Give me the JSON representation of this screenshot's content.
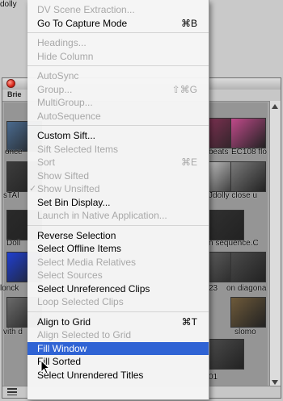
{
  "bin": {
    "tab_label": "Brie",
    "thumbnails": [
      {
        "label": "once",
        "color": "#4a6a8e"
      },
      {
        "label": "",
        "color": "#6a4e58"
      },
      {
        "label": "beats",
        "color": "#7a3050"
      },
      {
        "label": "EC108 flo",
        "color": "#c04a8a"
      },
      {
        "label": "sTAI",
        "color": "#3c3c3c"
      },
      {
        "label": "dolly",
        "color": "#b8b8b8"
      },
      {
        "label": "Jdolly close u",
        "color": "#7a7a7a"
      },
      {
        "label": "Doll",
        "color": "#2a2a2a"
      },
      {
        "label": "n sequence.C",
        "color": "#303030"
      },
      {
        "label": "lonck",
        "color": "#1f3fd0"
      },
      {
        "label": "23",
        "color": "#5a5a5a"
      },
      {
        "label": "on diagona",
        "color": "#4a4a4a"
      },
      {
        "label": "vith d",
        "color": "#6a6a6a"
      },
      {
        "label": "slomo",
        "color": "#6e5a3a"
      },
      {
        "label": "01",
        "color": "#4a4a4a"
      }
    ]
  },
  "menu": {
    "items": [
      {
        "label": "DV Scene Extraction...",
        "disabled": true,
        "shortcut": ""
      },
      {
        "label": "Go To Capture Mode",
        "disabled": false,
        "shortcut": "⌘B"
      },
      {
        "sep": true
      },
      {
        "label": "Headings...",
        "disabled": true,
        "shortcut": ""
      },
      {
        "label": "Hide Column",
        "disabled": true,
        "shortcut": ""
      },
      {
        "sep": true
      },
      {
        "label": "AutoSync",
        "disabled": true,
        "shortcut": ""
      },
      {
        "label": "Group...",
        "disabled": true,
        "shortcut": "⇧⌘G"
      },
      {
        "label": "MultiGroup...",
        "disabled": true,
        "shortcut": ""
      },
      {
        "label": "AutoSequence",
        "disabled": true,
        "shortcut": ""
      },
      {
        "sep": true
      },
      {
        "label": "Custom Sift...",
        "disabled": false,
        "shortcut": ""
      },
      {
        "label": "Sift Selected Items",
        "disabled": true,
        "shortcut": ""
      },
      {
        "label": "Sort",
        "disabled": true,
        "shortcut": "⌘E"
      },
      {
        "label": "Show Sifted",
        "disabled": true,
        "shortcut": ""
      },
      {
        "label": "Show Unsifted",
        "disabled": true,
        "shortcut": "",
        "checked": true
      },
      {
        "label": "Set Bin Display...",
        "disabled": false,
        "shortcut": ""
      },
      {
        "label": "Launch in Native Application...",
        "disabled": true,
        "shortcut": ""
      },
      {
        "sep": true
      },
      {
        "label": "Reverse Selection",
        "disabled": false,
        "shortcut": ""
      },
      {
        "label": "Select Offline Items",
        "disabled": false,
        "shortcut": ""
      },
      {
        "label": "Select Media Relatives",
        "disabled": true,
        "shortcut": ""
      },
      {
        "label": "Select Sources",
        "disabled": true,
        "shortcut": ""
      },
      {
        "label": "Select Unreferenced Clips",
        "disabled": false,
        "shortcut": ""
      },
      {
        "label": "Loop Selected Clips",
        "disabled": true,
        "shortcut": ""
      },
      {
        "sep": true
      },
      {
        "label": "Align to Grid",
        "disabled": false,
        "shortcut": "⌘T"
      },
      {
        "label": "Align Selected to Grid",
        "disabled": true,
        "shortcut": ""
      },
      {
        "label": "Fill Window",
        "disabled": false,
        "shortcut": "",
        "highlight": true
      },
      {
        "label": "Fill Sorted",
        "disabled": false,
        "shortcut": ""
      },
      {
        "label": "Select Unrendered Titles",
        "disabled": false,
        "shortcut": ""
      }
    ]
  }
}
